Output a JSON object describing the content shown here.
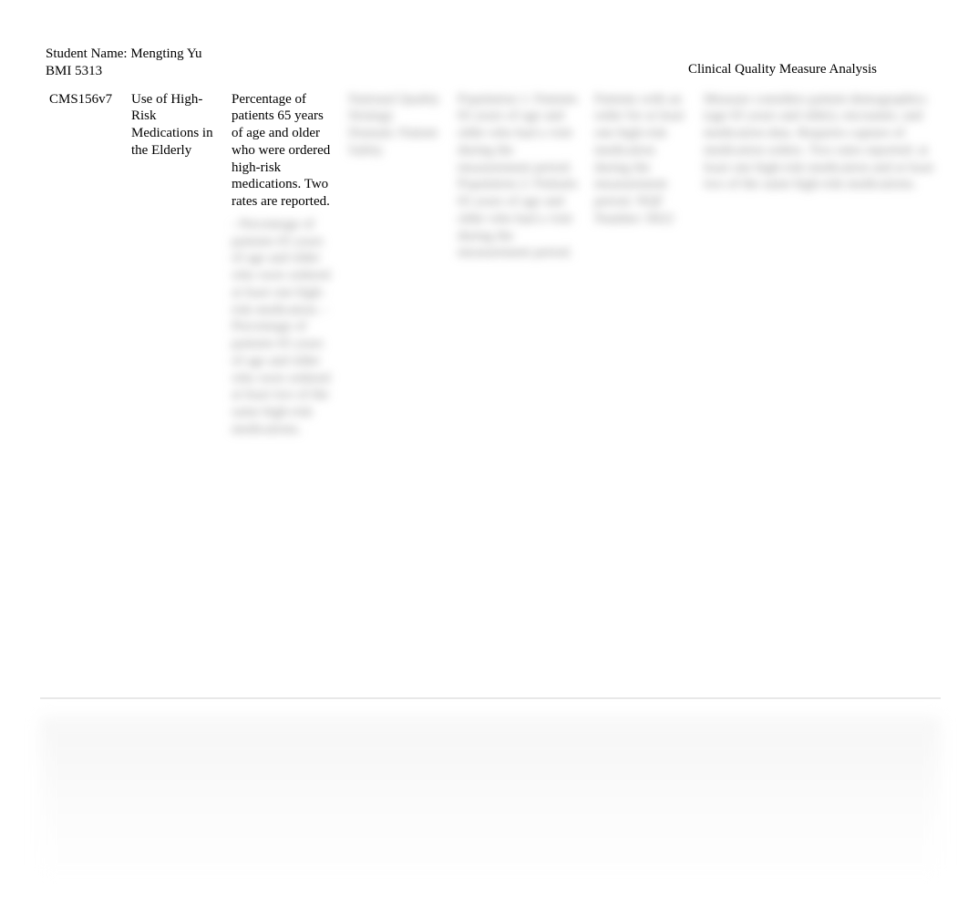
{
  "header": {
    "student_label": "Student Name: ",
    "student_name": "Mengting Yu",
    "course": "BMI 5313",
    "title": "Clinical Quality Measure Analysis"
  },
  "row": {
    "id": "CMS156v7",
    "title": "Use of High-Risk Medications in the Elderly",
    "description_clear": "Percentage of patients 65 years of age and older who were ordered high-risk medications. Two rates are reported.",
    "description_blur": "- Percentage of patients 65 years of age and older who were ordered at least one high-risk medication. - Percentage of patients 65 years of age and older who were ordered at least two of the same high-risk medications.",
    "c4": "National Quality Strategy Domain: Patient Safety",
    "c5": "Population 1: Patients 65 years of age and older who had a visit during the measurement period. Population 2: Patients 65 years of age and older who had a visit during the measurement period.",
    "c6": "Patients with an order for at least one high-risk medication during the measurement period. NQF Number: 0022",
    "c7": "Measure considers patient demographics (age 65 years and older), encounter, and medication data. Requires capture of medication orders. Two rates reported: at least one high-risk medication and at least two of the same high-risk medications."
  }
}
